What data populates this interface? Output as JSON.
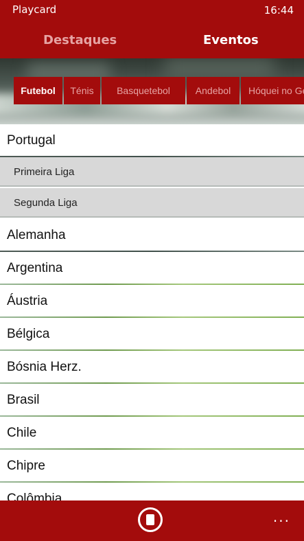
{
  "status": {
    "app_name": "Playcard",
    "time": "16:44"
  },
  "pivot": {
    "tabs": [
      {
        "label": "Destaques"
      },
      {
        "label": "Eventos"
      }
    ],
    "active": "Eventos"
  },
  "sports": {
    "items": [
      {
        "label": "Futebol"
      },
      {
        "label": "Ténis"
      },
      {
        "label": "Basquetebol"
      },
      {
        "label": "Andebol"
      },
      {
        "label": "Hóquei no Gelo"
      }
    ],
    "active": "Futebol"
  },
  "list": {
    "countries": [
      {
        "label": "Portugal"
      },
      {
        "label": "Alemanha"
      },
      {
        "label": "Argentina"
      },
      {
        "label": "Áustria"
      },
      {
        "label": "Bélgica"
      },
      {
        "label": "Bósnia Herz."
      },
      {
        "label": "Brasil"
      },
      {
        "label": "Chile"
      },
      {
        "label": "Chipre"
      },
      {
        "label": "Colômbia"
      }
    ],
    "portugal_leagues": [
      {
        "label": "Primeira Liga"
      },
      {
        "label": "Segunda Liga"
      }
    ]
  },
  "appbar": {
    "more_label": "...",
    "icon": "card-icon"
  },
  "colors": {
    "accent": "#a30c0c",
    "inactive_text": "#e6a3a3"
  }
}
